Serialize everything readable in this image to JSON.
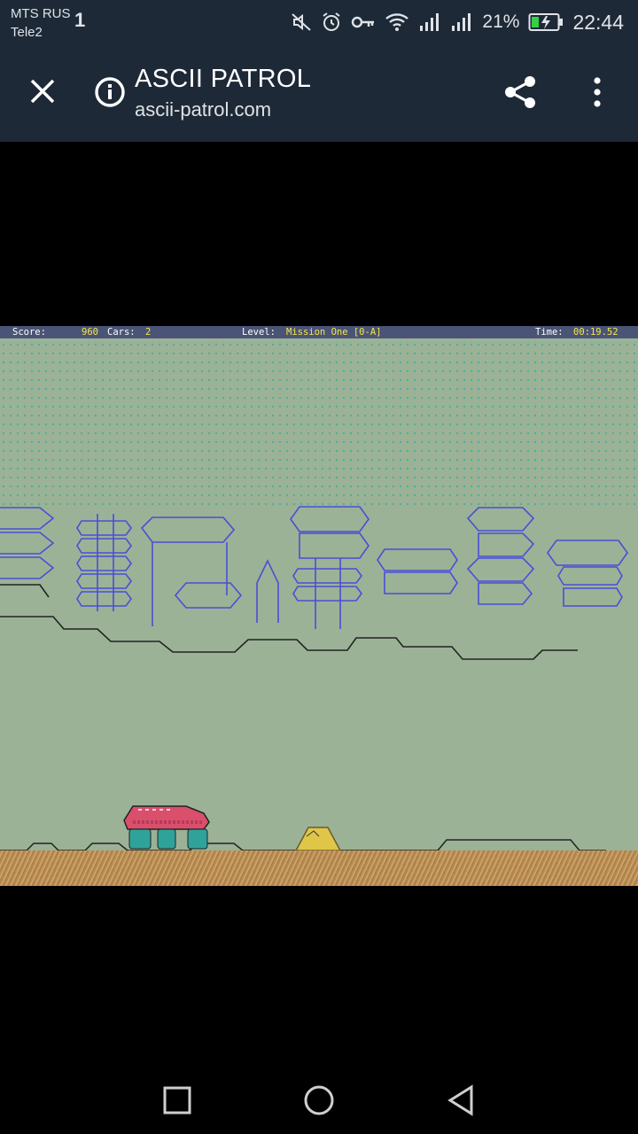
{
  "status": {
    "carrier1": "MTS RUS",
    "carrier2": "Tele2",
    "net_badge": "1",
    "battery_percent": "21%",
    "time": "22:44",
    "icons": [
      "mute-icon",
      "alarm-icon",
      "key-icon",
      "wifi-icon",
      "signal-icon",
      "signal-icon",
      "battery-charging-icon"
    ]
  },
  "toolbar": {
    "title": "ASCII PATROL",
    "url": "ascii-patrol.com"
  },
  "game": {
    "score_label": "Score:",
    "score_value": "960",
    "cars_label": "Cars:",
    "cars_value": "2",
    "level_label": "Level:",
    "level_value": "Mission One [0-A]",
    "time_label": "Time:",
    "time_value": "00:19.52"
  },
  "nav": {
    "icons": [
      "recents-icon",
      "home-icon",
      "back-icon"
    ]
  }
}
